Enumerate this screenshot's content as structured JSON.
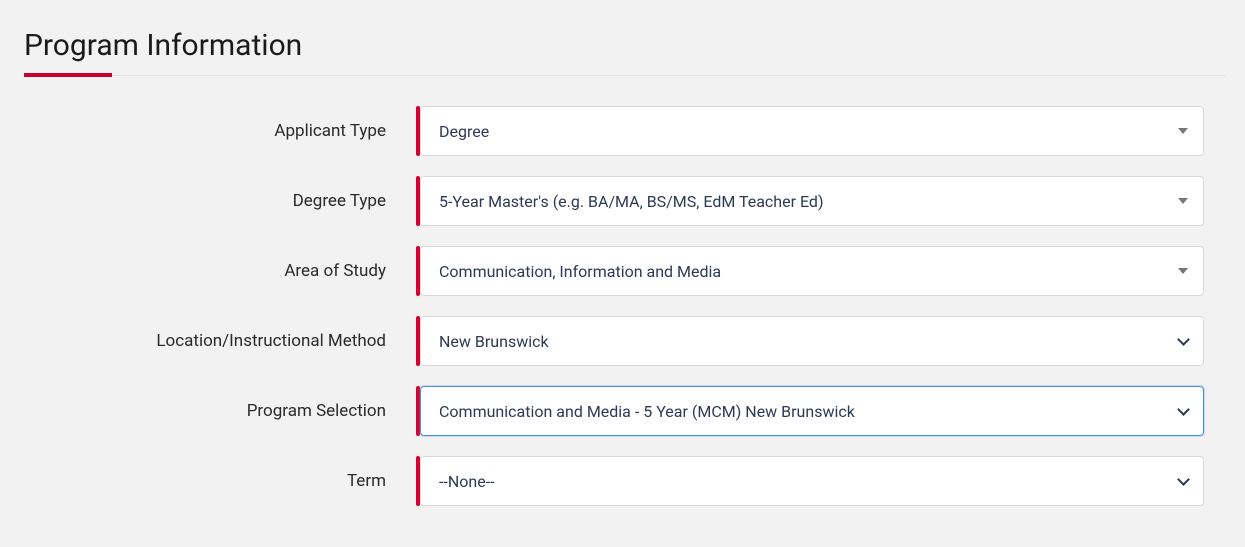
{
  "heading": "Program Information",
  "fields": {
    "applicant_type": {
      "label": "Applicant Type",
      "value": "Degree"
    },
    "degree_type": {
      "label": "Degree Type",
      "value": "5-Year Master's (e.g. BA/MA, BS/MS, EdM Teacher Ed)"
    },
    "area_of_study": {
      "label": "Area of Study",
      "value": "Communication, Information and Media"
    },
    "location": {
      "label": "Location/Instructional Method",
      "value": "New Brunswick"
    },
    "program": {
      "label": "Program Selection",
      "value": "Communication and Media - 5 Year (MCM) New Brunswick"
    },
    "term": {
      "label": "Term",
      "value": "--None--"
    }
  }
}
